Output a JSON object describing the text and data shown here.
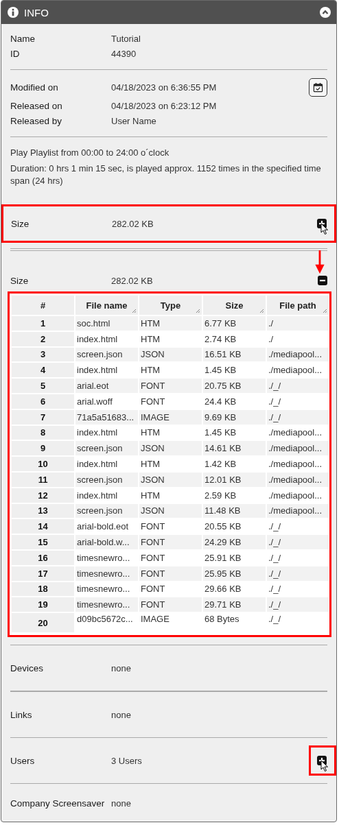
{
  "header": {
    "title": "INFO",
    "expanded": true
  },
  "identity": [
    {
      "label": "Name",
      "value": "Tutorial"
    },
    {
      "label": "ID",
      "value": "44390"
    }
  ],
  "dates": [
    {
      "label": "Modified on",
      "value": "04/18/2023 on 6:36:55 PM"
    },
    {
      "label": "Released on",
      "value": "04/18/2023 on 6:23:12 PM"
    },
    {
      "label": "Released by",
      "value": "User Name"
    }
  ],
  "schedule": [
    "Play Playlist from 00:00 to 24:00 o´clock",
    "Duration: 0 hrs 1 min 15 sec, is played approx. 1152 times in the specified time span (24 hrs)"
  ],
  "size_collapsed": {
    "label": "Size",
    "value": "282.02 KB",
    "expanded": false,
    "highlighted": true,
    "hovered": true
  },
  "size_expanded": {
    "label": "Size",
    "value": "282.02 KB",
    "expanded": true
  },
  "files": {
    "highlighted": true,
    "columns": [
      "#",
      "File name",
      "Type",
      "Size",
      "File path"
    ],
    "rows": [
      [
        "1",
        "soc.html",
        "HTM",
        "6.77 KB",
        "./"
      ],
      [
        "2",
        "index.html",
        "HTM",
        "2.74 KB",
        "./"
      ],
      [
        "3",
        "screen.json",
        "JSON",
        "16.51 KB",
        "./mediapool..."
      ],
      [
        "4",
        "index.html",
        "HTM",
        "1.45 KB",
        "./mediapool..."
      ],
      [
        "5",
        "arial.eot",
        "FONT",
        "20.75 KB",
        "./_/"
      ],
      [
        "6",
        "arial.woff",
        "FONT",
        "24.4 KB",
        "./_/"
      ],
      [
        "7",
        "71a5a51683...",
        "IMAGE",
        "9.69 KB",
        "./_/"
      ],
      [
        "8",
        "index.html",
        "HTM",
        "1.45 KB",
        "./mediapool..."
      ],
      [
        "9",
        "screen.json",
        "JSON",
        "14.61 KB",
        "./mediapool..."
      ],
      [
        "10",
        "index.html",
        "HTM",
        "1.42 KB",
        "./mediapool..."
      ],
      [
        "11",
        "screen.json",
        "JSON",
        "12.01 KB",
        "./mediapool..."
      ],
      [
        "12",
        "index.html",
        "HTM",
        "2.59 KB",
        "./mediapool..."
      ],
      [
        "13",
        "screen.json",
        "JSON",
        "11.48 KB",
        "./mediapool..."
      ],
      [
        "14",
        "arial-bold.eot",
        "FONT",
        "20.55 KB",
        "./_/"
      ],
      [
        "15",
        "arial-bold.w...",
        "FONT",
        "24.29 KB",
        "./_/"
      ],
      [
        "16",
        "timesnewro...",
        "FONT",
        "25.91 KB",
        "./_/"
      ],
      [
        "17",
        "timesnewro...",
        "FONT",
        "25.95 KB",
        "./_/"
      ],
      [
        "18",
        "timesnewro...",
        "FONT",
        "29.66 KB",
        "./_/"
      ],
      [
        "19",
        "timesnewro...",
        "FONT",
        "29.71 KB",
        "./_/"
      ],
      [
        "20",
        "d09bc5672c...",
        "IMAGE",
        "68 Bytes",
        "./_/"
      ]
    ]
  },
  "sections": [
    {
      "label": "Devices",
      "value": "none"
    },
    {
      "label": "Links",
      "value": "none"
    },
    {
      "label": "Users",
      "value": "3 Users",
      "toggle": {
        "expanded": false,
        "highlighted": true,
        "hovered": true
      }
    },
    {
      "label": "Company Screensaver",
      "value": "none"
    }
  ]
}
